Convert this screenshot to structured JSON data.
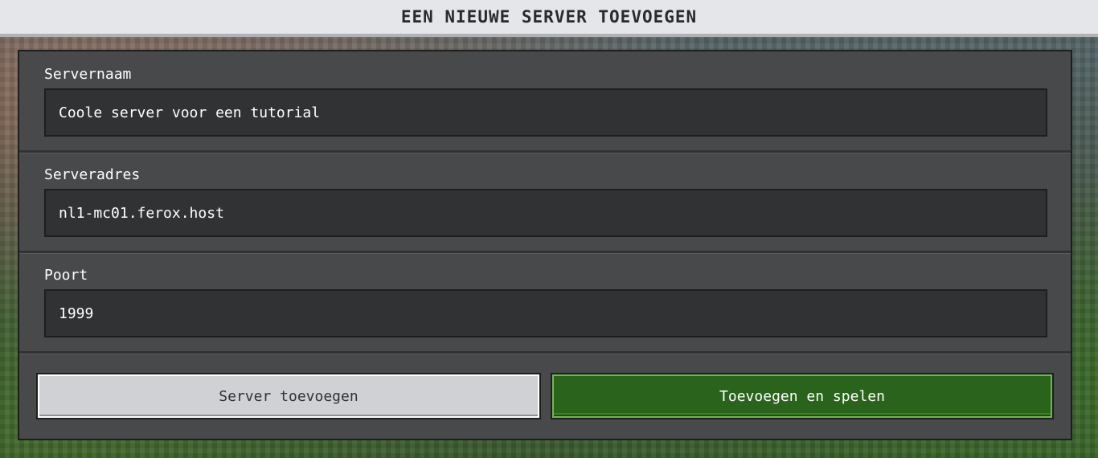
{
  "window": {
    "title": "EEN NIEUWE SERVER TOEVOEGEN"
  },
  "form": {
    "server_name": {
      "label": "Servernaam",
      "value": "Coole server voor een tutorial"
    },
    "server_address": {
      "label": "Serveradres",
      "value": "nl1-mc01.ferox.host"
    },
    "port": {
      "label": "Poort",
      "value": "1999"
    }
  },
  "actions": {
    "add_server_label": "Server toevoegen",
    "add_and_play_label": "Toevoegen en spelen"
  },
  "colors": {
    "primary_button": "#2a641c",
    "secondary_button": "#d0d1d4",
    "panel": "#48494a",
    "input": "#313233",
    "title_bar": "#e5e6ea"
  }
}
